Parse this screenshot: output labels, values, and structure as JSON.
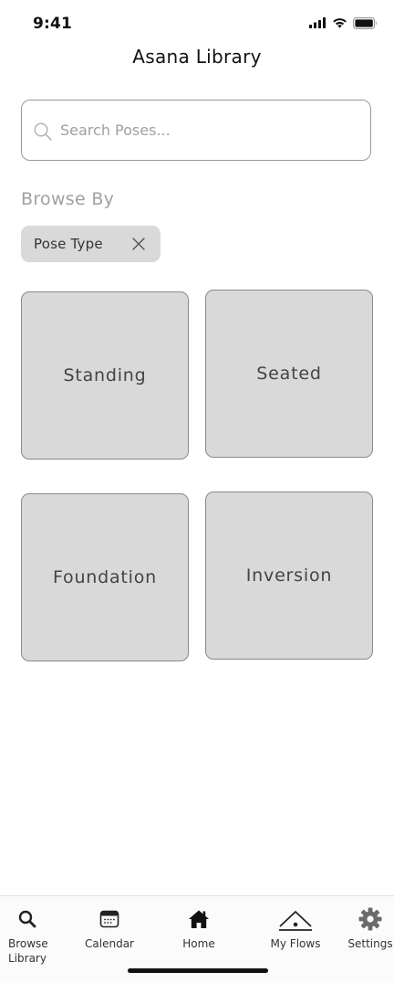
{
  "status_bar": {
    "time": "9:41"
  },
  "header": {
    "title": "Asana Library"
  },
  "search": {
    "placeholder": "Search Poses...",
    "value": ""
  },
  "browse": {
    "label": "Browse By",
    "active_filter": {
      "label": "Pose Type"
    }
  },
  "categories": [
    {
      "label": "Standing"
    },
    {
      "label": "Seated"
    },
    {
      "label": "Foundation"
    },
    {
      "label": "Inversion"
    }
  ],
  "tab_bar": {
    "items": [
      {
        "label": "Browse Library",
        "icon": "search-icon"
      },
      {
        "label": "Calendar",
        "icon": "calendar-icon"
      },
      {
        "label": "Home",
        "icon": "home-icon"
      },
      {
        "label": "My Flows",
        "icon": "flows-icon"
      },
      {
        "label": "Settings",
        "icon": "gear-icon"
      }
    ]
  },
  "colors": {
    "tile_fill": "#d9d9d9",
    "tile_border": "#8a8a8a",
    "muted_text": "#a0a0a0",
    "text": "#111111"
  }
}
